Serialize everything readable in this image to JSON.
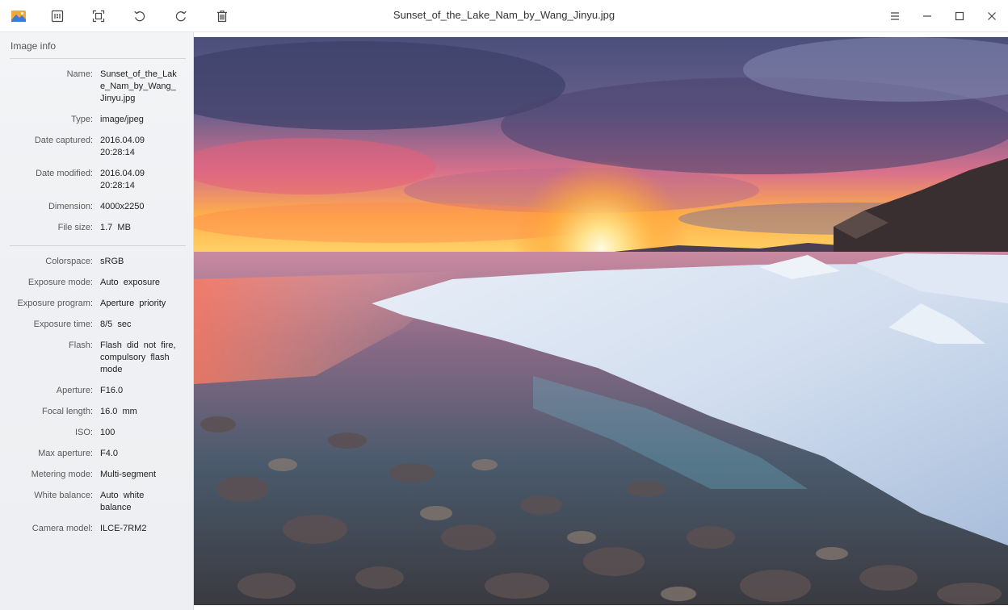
{
  "window": {
    "title": "Sunset_of_the_Lake_Nam_by_Wang_Jinyu.jpg"
  },
  "toolbar": {
    "icons": [
      "app-logo-icon",
      "actual-size-icon",
      "fit-window-icon",
      "rotate-left-icon",
      "rotate-right-icon",
      "delete-icon"
    ]
  },
  "window_controls": {
    "icons": [
      "menu-icon",
      "minimize-icon",
      "maximize-icon",
      "close-icon"
    ]
  },
  "info_panel": {
    "title": "Image info",
    "basic": [
      {
        "label": "Name:",
        "value": "Sunset_of_the_Lake_Nam_by_Wang_Jinyu.jpg"
      },
      {
        "label": "Type:",
        "value": "image/jpeg"
      },
      {
        "label": "Date captured:",
        "value": "2016.04.09 20:28:14"
      },
      {
        "label": "Date modified:",
        "value": "2016.04.09 20:28:14"
      },
      {
        "label": "Dimension:",
        "value": "4000x2250"
      },
      {
        "label": "File size:",
        "value": "1.7  MB"
      }
    ],
    "details": [
      {
        "label": "Colorspace:",
        "value": "sRGB"
      },
      {
        "label": "Exposure mode:",
        "value": "Auto  exposure"
      },
      {
        "label": "Exposure program:",
        "value": "Aperture  priority"
      },
      {
        "label": "Exposure time:",
        "value": "8/5  sec"
      },
      {
        "label": "Flash:",
        "value": "Flash  did  not  fire, compulsory  flash mode"
      },
      {
        "label": "Aperture:",
        "value": "F16.0"
      },
      {
        "label": "Focal length:",
        "value": "16.0  mm"
      },
      {
        "label": "ISO:",
        "value": "100"
      },
      {
        "label": "Max aperture:",
        "value": "F4.0"
      },
      {
        "label": "Metering mode:",
        "value": "Multi-segment"
      },
      {
        "label": "White balance:",
        "value": "Auto  white balance"
      },
      {
        "label": "Camera model:",
        "value": "ILCE-7RM2"
      }
    ]
  },
  "colors": {
    "panel_bg": "#eef0f3",
    "titlebar_bg": "#ffffff",
    "text": "#333333"
  }
}
